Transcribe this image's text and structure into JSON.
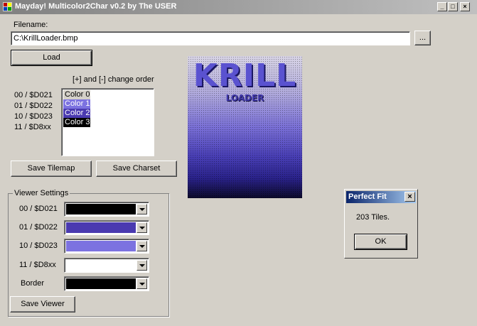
{
  "window": {
    "title": "Mayday! Multicolor2Char v0.2 by The USER",
    "controls": [
      "_",
      "□",
      "×"
    ]
  },
  "file": {
    "label": "Filename:",
    "value": "C:\\KrillLoader.bmp",
    "browse_label": "...",
    "load_label": "Load"
  },
  "order": {
    "hint": "[+] and [-] change order",
    "registers": [
      "00 / $D021",
      "01 / $D022",
      "10 / $D023",
      "11 / $D8xx"
    ],
    "items": [
      {
        "label": "Color 0",
        "bg": "#d4d0c8",
        "fg": "#000000"
      },
      {
        "label": "Color 1",
        "bg": "#7c72e0",
        "fg": "#ffffff"
      },
      {
        "label": "Color 2",
        "bg": "#4a3ab0",
        "fg": "#ffffff"
      },
      {
        "label": "Color 3",
        "bg": "#000000",
        "fg": "#ffffff"
      }
    ]
  },
  "buttons": {
    "save_tilemap": "Save Tilemap",
    "save_charset": "Save Charset",
    "save_viewer": "Save Viewer"
  },
  "viewer": {
    "title": "Viewer Settings",
    "rows": [
      {
        "label": "00 / $D021",
        "color": "#000000"
      },
      {
        "label": "01 / $D022",
        "color": "#4a3ab0"
      },
      {
        "label": "10 / $D023",
        "color": "#7c72e0"
      },
      {
        "label": "11 / $D8xx",
        "color": "#ffffff"
      },
      {
        "label": "Border",
        "color": "#000000"
      }
    ]
  },
  "preview": {
    "logo_text": "KRILL",
    "sub_text": "LOADER"
  },
  "dialog": {
    "title": "Perfect Fit",
    "close": "×",
    "message": "203 Tiles.",
    "ok_label": "OK"
  }
}
